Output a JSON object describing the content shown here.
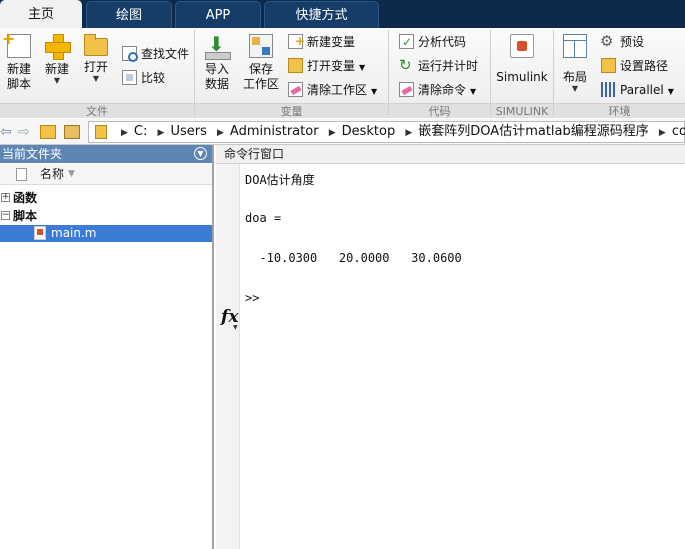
{
  "tabs": [
    {
      "label": "主页",
      "active": true
    },
    {
      "label": "绘图",
      "active": false
    },
    {
      "label": "APP",
      "active": false
    },
    {
      "label": "快捷方式",
      "active": false
    }
  ],
  "ribbon": {
    "file": {
      "group_label": "文件",
      "new_script": "新建\n脚本",
      "new": "新建",
      "open": "打开",
      "find_files": "查找文件",
      "compare": "比较"
    },
    "variable": {
      "group_label": "变量",
      "import_data": "导入\n数据",
      "save_workspace": "保存\n工作区",
      "new_variable": "新建变量",
      "open_variable": "打开变量",
      "clear_workspace": "清除工作区"
    },
    "code": {
      "group_label": "代码",
      "analyze_code": "分析代码",
      "run_and_time": "运行并计时",
      "clear_commands": "清除命令"
    },
    "simulink": {
      "group_label": "SIMULINK",
      "simulink": "Simulink"
    },
    "environment": {
      "group_label": "环境",
      "layout": "布局",
      "preferences": "预设",
      "set_path": "设置路径",
      "parallel": "Parallel"
    }
  },
  "address": {
    "crumbs": [
      "C:",
      "Users",
      "Administrator",
      "Desktop",
      "嵌套阵列DOA估计matlab编程源码程序",
      "code"
    ]
  },
  "current_folder": {
    "title": "当前文件夹",
    "column_name": "名称",
    "nodes": [
      {
        "label": "函数",
        "expanded": false
      },
      {
        "label": "脚本",
        "expanded": true
      }
    ],
    "selected_file": "main.m"
  },
  "command_window": {
    "title": "命令行窗口",
    "lines": [
      "DOA估计角度",
      "doa =",
      "  -10.0300   20.0000   30.0600"
    ],
    "prompt": ">>",
    "fx_label": "fx"
  }
}
